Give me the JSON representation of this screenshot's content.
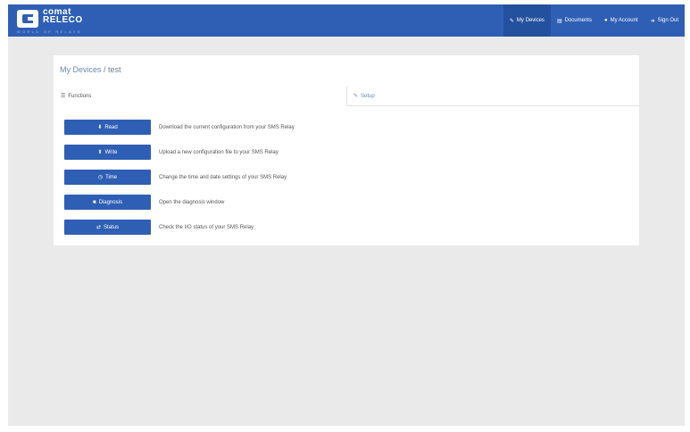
{
  "brand": {
    "name_line1": "comat",
    "name_line2": "RELECO",
    "tagline": "WORLD OF RELAYS",
    "colors": {
      "primary": "#2f5fb4",
      "active_nav": "#24519e",
      "background": "#eaeaea"
    }
  },
  "nav": [
    {
      "icon": "wrench-icon",
      "glyph": "✎",
      "label": "My Devices",
      "active": true
    },
    {
      "icon": "document-icon",
      "glyph": "▤",
      "label": "Documents",
      "active": false
    },
    {
      "icon": "account-icon",
      "glyph": "●",
      "label": "My Account",
      "active": false
    },
    {
      "icon": "sign-out-icon",
      "glyph": "➜",
      "label": "Sign Out",
      "active": false
    }
  ],
  "breadcrumb": {
    "link": "My Devices",
    "separator": " / ",
    "current": "test"
  },
  "tabs": [
    {
      "icon": "list-icon",
      "glyph": "☰",
      "label": "Functions",
      "active": true
    },
    {
      "icon": "edit-icon",
      "glyph": "✎",
      "label": "Setup",
      "active": false
    }
  ],
  "functions": [
    {
      "icon": "download-icon",
      "glyph": "⬇",
      "label": "Read",
      "description": "Download the current configuration from your SMS Relay"
    },
    {
      "icon": "upload-icon",
      "glyph": "⬆",
      "label": "Write",
      "description": "Upload a new configuration file to your SMS Relay"
    },
    {
      "icon": "clock-icon",
      "glyph": "◷",
      "label": "Time",
      "description": "Change the time and date settings of your SMS Relay"
    },
    {
      "icon": "briefcase-icon",
      "glyph": "■",
      "label": "Diagnosis",
      "description": "Open the diagnosis window"
    },
    {
      "icon": "status-icon",
      "glyph": "⇄",
      "label": "Status",
      "description": "Check the I/O status of your SMS Relay"
    }
  ]
}
